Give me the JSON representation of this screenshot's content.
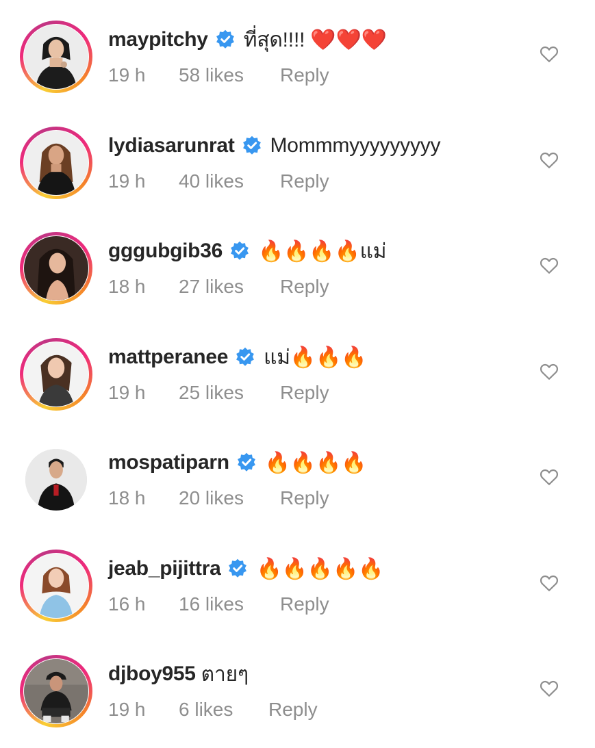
{
  "comments": [
    {
      "username": "maypitchy",
      "verified": true,
      "text": "ที่สุด!!!! ❤️❤️❤️",
      "time": "19 h",
      "likes": "58 likes",
      "reply": "Reply",
      "avatar": "woman-black-outfit"
    },
    {
      "username": "lydiasarunrat",
      "verified": true,
      "text": "Mommmyyyyyyyyy",
      "time": "19 h",
      "likes": "40 likes",
      "reply": "Reply",
      "avatar": "woman-long-hair-blazer"
    },
    {
      "username": "gggubgib36",
      "verified": true,
      "text": "🔥🔥🔥🔥แม่",
      "time": "18 h",
      "likes": "27 likes",
      "reply": "Reply",
      "avatar": "woman-dark-hair"
    },
    {
      "username": "mattperanee",
      "verified": true,
      "text": "แม่🔥🔥🔥",
      "time": "19 h",
      "likes": "25 likes",
      "reply": "Reply",
      "avatar": "woman-portrait"
    },
    {
      "username": "mospatiparn",
      "verified": true,
      "text": "🔥🔥🔥🔥",
      "time": "18 h",
      "likes": "20 likes",
      "reply": "Reply",
      "avatar": "man-leather-jacket"
    },
    {
      "username": "jeab_pijittra",
      "verified": true,
      "text": "🔥🔥🔥🔥🔥",
      "time": "16 h",
      "likes": "16 likes",
      "reply": "Reply",
      "avatar": "woman-blue-top"
    },
    {
      "username": "djboy955",
      "verified": false,
      "text": "ตายๆ",
      "time": "19 h",
      "likes": "6 likes",
      "reply": "Reply",
      "avatar": "man-sitting-cap"
    }
  ],
  "colors": {
    "verified_badge": "#3897f0",
    "secondary_text": "#8e8e8e",
    "primary_text": "#262626"
  },
  "icons": {
    "verified": "verified-badge-icon",
    "like": "heart-outline-icon"
  }
}
